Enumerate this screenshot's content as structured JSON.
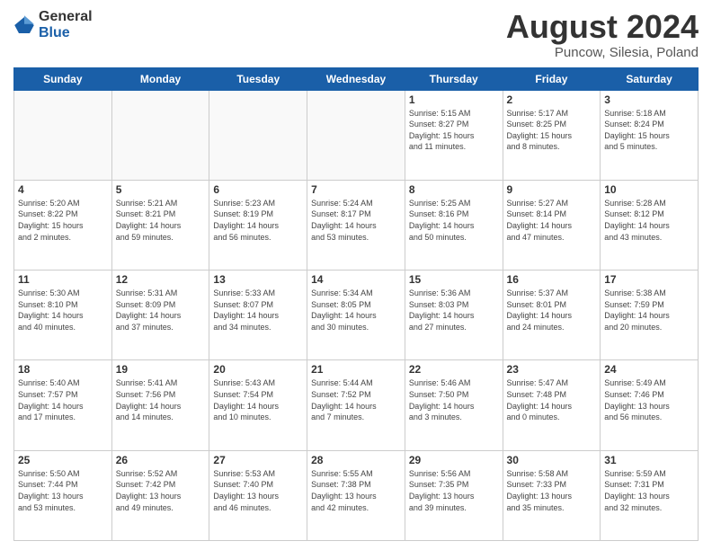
{
  "header": {
    "logo_general": "General",
    "logo_blue": "Blue",
    "month_title": "August 2024",
    "location": "Puncow, Silesia, Poland"
  },
  "days_of_week": [
    "Sunday",
    "Monday",
    "Tuesday",
    "Wednesday",
    "Thursday",
    "Friday",
    "Saturday"
  ],
  "weeks": [
    [
      {
        "num": "",
        "info": ""
      },
      {
        "num": "",
        "info": ""
      },
      {
        "num": "",
        "info": ""
      },
      {
        "num": "",
        "info": ""
      },
      {
        "num": "1",
        "info": "Sunrise: 5:15 AM\nSunset: 8:27 PM\nDaylight: 15 hours\nand 11 minutes."
      },
      {
        "num": "2",
        "info": "Sunrise: 5:17 AM\nSunset: 8:25 PM\nDaylight: 15 hours\nand 8 minutes."
      },
      {
        "num": "3",
        "info": "Sunrise: 5:18 AM\nSunset: 8:24 PM\nDaylight: 15 hours\nand 5 minutes."
      }
    ],
    [
      {
        "num": "4",
        "info": "Sunrise: 5:20 AM\nSunset: 8:22 PM\nDaylight: 15 hours\nand 2 minutes."
      },
      {
        "num": "5",
        "info": "Sunrise: 5:21 AM\nSunset: 8:21 PM\nDaylight: 14 hours\nand 59 minutes."
      },
      {
        "num": "6",
        "info": "Sunrise: 5:23 AM\nSunset: 8:19 PM\nDaylight: 14 hours\nand 56 minutes."
      },
      {
        "num": "7",
        "info": "Sunrise: 5:24 AM\nSunset: 8:17 PM\nDaylight: 14 hours\nand 53 minutes."
      },
      {
        "num": "8",
        "info": "Sunrise: 5:25 AM\nSunset: 8:16 PM\nDaylight: 14 hours\nand 50 minutes."
      },
      {
        "num": "9",
        "info": "Sunrise: 5:27 AM\nSunset: 8:14 PM\nDaylight: 14 hours\nand 47 minutes."
      },
      {
        "num": "10",
        "info": "Sunrise: 5:28 AM\nSunset: 8:12 PM\nDaylight: 14 hours\nand 43 minutes."
      }
    ],
    [
      {
        "num": "11",
        "info": "Sunrise: 5:30 AM\nSunset: 8:10 PM\nDaylight: 14 hours\nand 40 minutes."
      },
      {
        "num": "12",
        "info": "Sunrise: 5:31 AM\nSunset: 8:09 PM\nDaylight: 14 hours\nand 37 minutes."
      },
      {
        "num": "13",
        "info": "Sunrise: 5:33 AM\nSunset: 8:07 PM\nDaylight: 14 hours\nand 34 minutes."
      },
      {
        "num": "14",
        "info": "Sunrise: 5:34 AM\nSunset: 8:05 PM\nDaylight: 14 hours\nand 30 minutes."
      },
      {
        "num": "15",
        "info": "Sunrise: 5:36 AM\nSunset: 8:03 PM\nDaylight: 14 hours\nand 27 minutes."
      },
      {
        "num": "16",
        "info": "Sunrise: 5:37 AM\nSunset: 8:01 PM\nDaylight: 14 hours\nand 24 minutes."
      },
      {
        "num": "17",
        "info": "Sunrise: 5:38 AM\nSunset: 7:59 PM\nDaylight: 14 hours\nand 20 minutes."
      }
    ],
    [
      {
        "num": "18",
        "info": "Sunrise: 5:40 AM\nSunset: 7:57 PM\nDaylight: 14 hours\nand 17 minutes."
      },
      {
        "num": "19",
        "info": "Sunrise: 5:41 AM\nSunset: 7:56 PM\nDaylight: 14 hours\nand 14 minutes."
      },
      {
        "num": "20",
        "info": "Sunrise: 5:43 AM\nSunset: 7:54 PM\nDaylight: 14 hours\nand 10 minutes."
      },
      {
        "num": "21",
        "info": "Sunrise: 5:44 AM\nSunset: 7:52 PM\nDaylight: 14 hours\nand 7 minutes."
      },
      {
        "num": "22",
        "info": "Sunrise: 5:46 AM\nSunset: 7:50 PM\nDaylight: 14 hours\nand 3 minutes."
      },
      {
        "num": "23",
        "info": "Sunrise: 5:47 AM\nSunset: 7:48 PM\nDaylight: 14 hours\nand 0 minutes."
      },
      {
        "num": "24",
        "info": "Sunrise: 5:49 AM\nSunset: 7:46 PM\nDaylight: 13 hours\nand 56 minutes."
      }
    ],
    [
      {
        "num": "25",
        "info": "Sunrise: 5:50 AM\nSunset: 7:44 PM\nDaylight: 13 hours\nand 53 minutes."
      },
      {
        "num": "26",
        "info": "Sunrise: 5:52 AM\nSunset: 7:42 PM\nDaylight: 13 hours\nand 49 minutes."
      },
      {
        "num": "27",
        "info": "Sunrise: 5:53 AM\nSunset: 7:40 PM\nDaylight: 13 hours\nand 46 minutes."
      },
      {
        "num": "28",
        "info": "Sunrise: 5:55 AM\nSunset: 7:38 PM\nDaylight: 13 hours\nand 42 minutes."
      },
      {
        "num": "29",
        "info": "Sunrise: 5:56 AM\nSunset: 7:35 PM\nDaylight: 13 hours\nand 39 minutes."
      },
      {
        "num": "30",
        "info": "Sunrise: 5:58 AM\nSunset: 7:33 PM\nDaylight: 13 hours\nand 35 minutes."
      },
      {
        "num": "31",
        "info": "Sunrise: 5:59 AM\nSunset: 7:31 PM\nDaylight: 13 hours\nand 32 minutes."
      }
    ]
  ]
}
